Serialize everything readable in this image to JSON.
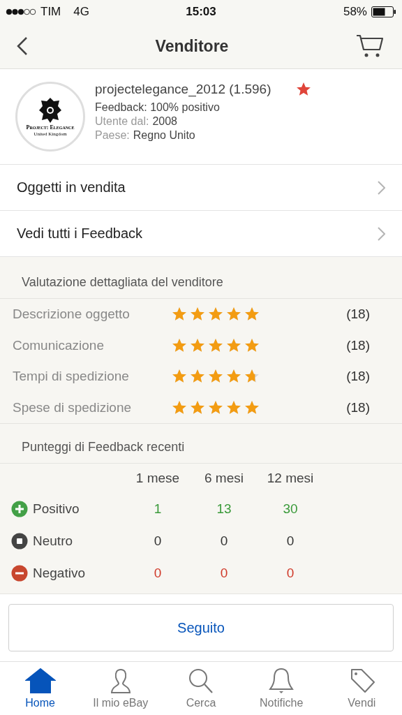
{
  "status_bar": {
    "carrier": "TIM",
    "network": "4G",
    "time": "15:03",
    "battery": "58%"
  },
  "nav": {
    "title": "Venditore"
  },
  "seller": {
    "logo_text": "Project: Elegance",
    "logo_subtext": "United Kingdom",
    "name": "projectelegance_2012 (1.596)",
    "starred": true,
    "feedback": "Feedback: 100% positivo",
    "since_label": "Utente dal:",
    "since": "2008",
    "country_label": "Paese:",
    "country": "Regno Unito"
  },
  "links": [
    {
      "label": "Oggetti in vendita"
    },
    {
      "label": "Vedi tutti i Feedback"
    }
  ],
  "ratings": {
    "title": "Valutazione dettagliata del venditore",
    "rows": [
      {
        "label": "Descrizione oggetto",
        "stars": 5,
        "count": "(18)"
      },
      {
        "label": "Comunicazione",
        "stars": 5,
        "count": "(18)"
      },
      {
        "label": "Tempi di spedizione",
        "stars": 4.7,
        "count": "(18)"
      },
      {
        "label": "Spese di spedizione",
        "stars": 5,
        "count": "(18)"
      }
    ]
  },
  "feedback": {
    "title": "Punteggi di Feedback recenti",
    "columns": [
      "1 mese",
      "6 mesi",
      "12 mesi"
    ],
    "rows": [
      {
        "kind": "positive",
        "label": "Positivo",
        "values": [
          "1",
          "13",
          "30"
        ]
      },
      {
        "kind": "neutral",
        "label": "Neutro",
        "values": [
          "0",
          "0",
          "0"
        ]
      },
      {
        "kind": "negative",
        "label": "Negativo",
        "values": [
          "0",
          "0",
          "0"
        ]
      }
    ]
  },
  "follow_button": "Seguito",
  "tabs": [
    {
      "label": "Home",
      "selected": true
    },
    {
      "label": "Il mio eBay",
      "selected": false
    },
    {
      "label": "Cerca",
      "selected": false
    },
    {
      "label": "Notifiche",
      "selected": false
    },
    {
      "label": "Vendi",
      "selected": false
    }
  ]
}
